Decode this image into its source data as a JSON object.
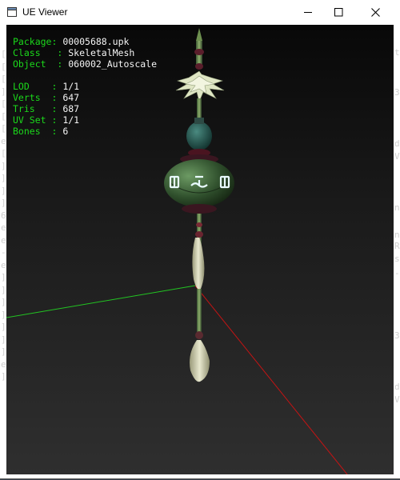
{
  "window": {
    "title": "UE Viewer",
    "minimize_icon": "minimize-icon",
    "maximize_icon": "maximize-icon",
    "close_icon": "close-icon"
  },
  "info": {
    "package_label": "Package",
    "package_value": "00005688.upk",
    "class_label": "Class",
    "class_value": "SkeletalMesh",
    "object_label": "Object",
    "object_value": "060002_Autoscale",
    "lod_label": "LOD",
    "lod_value": "1/1",
    "verts_label": "Verts",
    "verts_value": "647",
    "tris_label": "Tris",
    "tris_value": "687",
    "uvset_label": "UV Set",
    "uvset_value": "1/1",
    "bones_label": "Bones",
    "bones_value": "6"
  },
  "colors": {
    "label_green": "#1bd81b",
    "value_white": "#f4f4f4",
    "axis_green": "#22c422",
    "axis_red": "#c41414"
  },
  "background": {
    "left_glyphs": [
      "[",
      "[",
      "[",
      "]",
      "[",
      "[",
      "[",
      "e",
      "[",
      "]",
      "]",
      "]",
      "]",
      "6",
      "e",
      "e",
      "-",
      "e",
      "]",
      "]",
      "]",
      "]",
      "]",
      "]",
      "]",
      "e",
      "]"
    ],
    "right_glyphs": [
      "t",
      "3",
      "d",
      "V",
      "n",
      "n",
      "R",
      "s",
      "-",
      "3",
      "d",
      "V"
    ]
  }
}
